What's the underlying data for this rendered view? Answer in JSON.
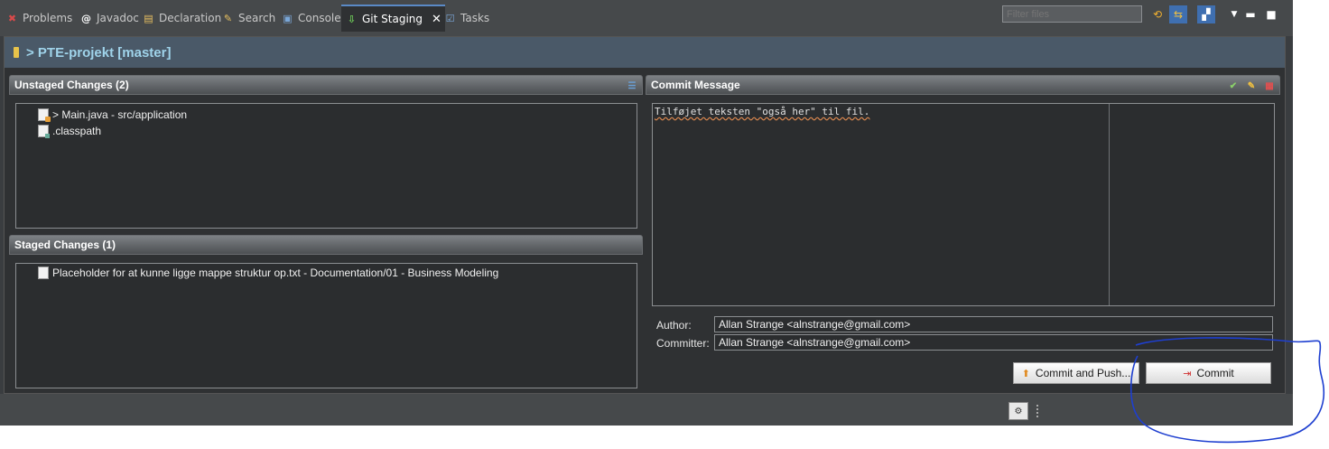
{
  "tabs": [
    {
      "label": "Problems",
      "icon": "problems-icon",
      "glyph": "✖",
      "color": "#d94a4a"
    },
    {
      "label": "Javadoc",
      "icon": "javadoc-icon",
      "glyph": "@",
      "color": "#ffffff"
    },
    {
      "label": "Declaration",
      "icon": "declaration-icon",
      "glyph": "▤",
      "color": "#e8c060"
    },
    {
      "label": "Search",
      "icon": "search-icon",
      "glyph": "✎",
      "color": "#e8c060"
    },
    {
      "label": "Console",
      "icon": "console-icon",
      "glyph": "▣",
      "color": "#7aa7d8"
    },
    {
      "label": "Git Staging",
      "icon": "git-staging-icon",
      "glyph": "⇩",
      "color": "#6fcf5a",
      "active": true
    },
    {
      "label": "Tasks",
      "icon": "tasks-icon",
      "glyph": "☑",
      "color": "#7aa7d8"
    }
  ],
  "toolbar": {
    "filter_placeholder": "Filter files",
    "buttons": [
      "refresh-icon",
      "compare-icon",
      "layout-icon",
      "view-menu-icon",
      "minimize-icon",
      "maximize-icon"
    ]
  },
  "repo": {
    "title": "> PTE-projekt [master]"
  },
  "unstaged": {
    "title": "Unstaged Changes (2)",
    "items": [
      {
        "label": "> Main.java - src/application",
        "icon": "java-file-icon"
      },
      {
        "label": ".classpath",
        "icon": "classpath-file-icon"
      }
    ]
  },
  "staged": {
    "title": "Staged Changes (1)",
    "items": [
      {
        "label": "Placeholder for at kunne ligge mappe struktur op.txt - Documentation/01 - Business Modeling",
        "icon": "text-file-icon"
      }
    ]
  },
  "commit": {
    "title": "Commit Message",
    "message": "Tilføjet teksten \"også her\" til fil.",
    "author_label": "Author:",
    "author_value": "Allan Strange <alnstrange@gmail.com>",
    "committer_label": "Committer:",
    "committer_value": "Allan Strange <alnstrange@gmail.com>",
    "commit_push_label": "Commit and Push...",
    "commit_label": "Commit"
  },
  "colors": {
    "repo_bar": "#4a5968",
    "repo_title": "#9fd3ea",
    "annotation": "#1e3fd0"
  }
}
